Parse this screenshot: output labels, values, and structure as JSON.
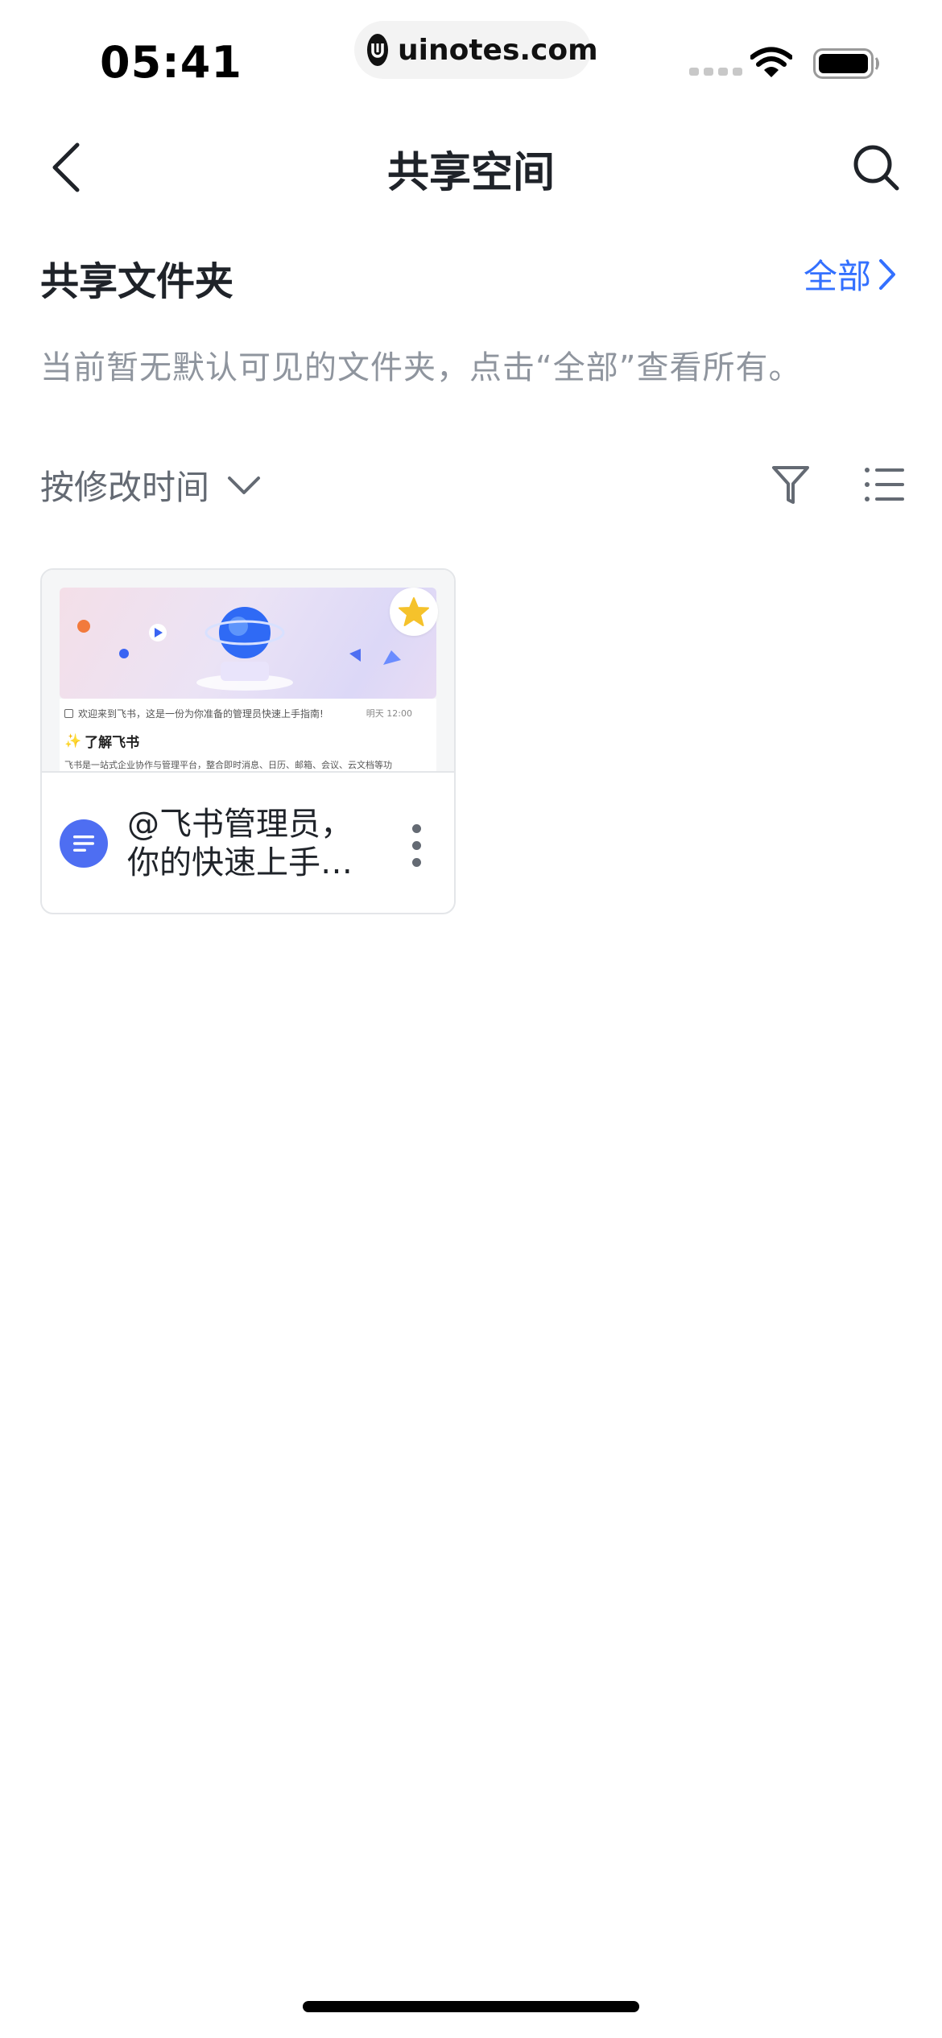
{
  "status_bar": {
    "time": "05:41",
    "url": "uinotes.com"
  },
  "nav": {
    "title": "共享空间"
  },
  "shared_folders": {
    "title": "共享文件夹",
    "all_label": "全部",
    "empty_hint": "当前暂无默认可见的文件夹，点击“全部”查看所有。"
  },
  "sort": {
    "label": "按修改时间"
  },
  "documents": [
    {
      "title_line1": "@飞书管理员，",
      "title_line2": "你的快速上手…",
      "starred": true,
      "thumbnail": {
        "line1": "欢迎来到飞书，这是一份为你准备的管理员快速上手指南!",
        "meta": "明天 12:00",
        "heading": "了解飞书",
        "body": "飞书是一站式企业协作与管理平台，整合即时消息、日历、邮箱、会议、云文档等功"
      }
    }
  ],
  "colors": {
    "accent": "#3370ff",
    "doc_icon": "#4e6ef2",
    "star": "#f5c22b",
    "secondary_text": "#8f959e"
  }
}
